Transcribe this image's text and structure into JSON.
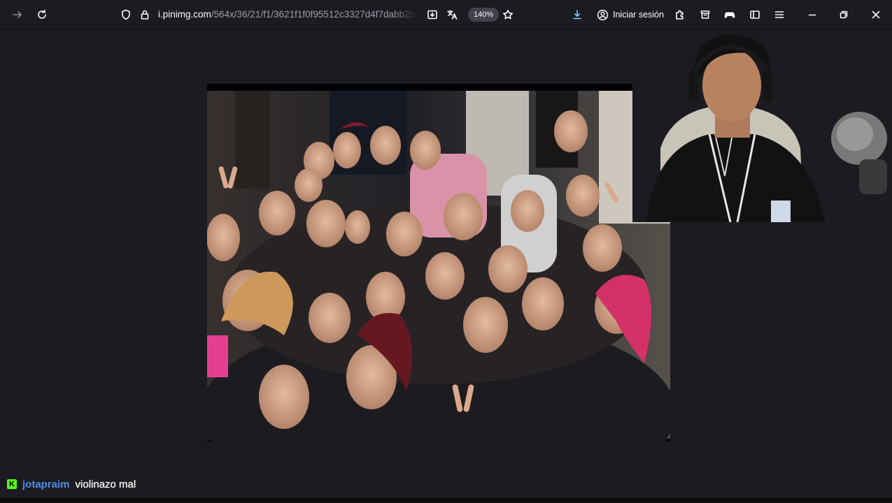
{
  "browser": {
    "url_host": "i.pinimg.com",
    "url_path": "/564x/36/21/f1/3621f1f0f95512c3327d4f7dabb2b",
    "zoom": "140%",
    "signin_label": "Iniciar sesión",
    "accent_color": "#7fd0ff"
  },
  "icons": {
    "forward": "arrow-right",
    "reload": "reload",
    "shield": "tracking-protection",
    "lock": "padlock",
    "reader": "reader-view",
    "translate": "translate",
    "bookmark": "star",
    "downloads": "download-arrow",
    "account": "user-circle",
    "extensions": "puzzle",
    "containers": "box",
    "profile": "game-controller",
    "sidebar": "sidebar",
    "menu": "hamburger",
    "minimize": "minus",
    "restore": "restore",
    "close": "x"
  },
  "chat": {
    "platform_badge": "K",
    "username": "jotapraim",
    "message": "violinazo mal",
    "username_color": "#4e8ee6",
    "badge_color": "#53fc18"
  }
}
